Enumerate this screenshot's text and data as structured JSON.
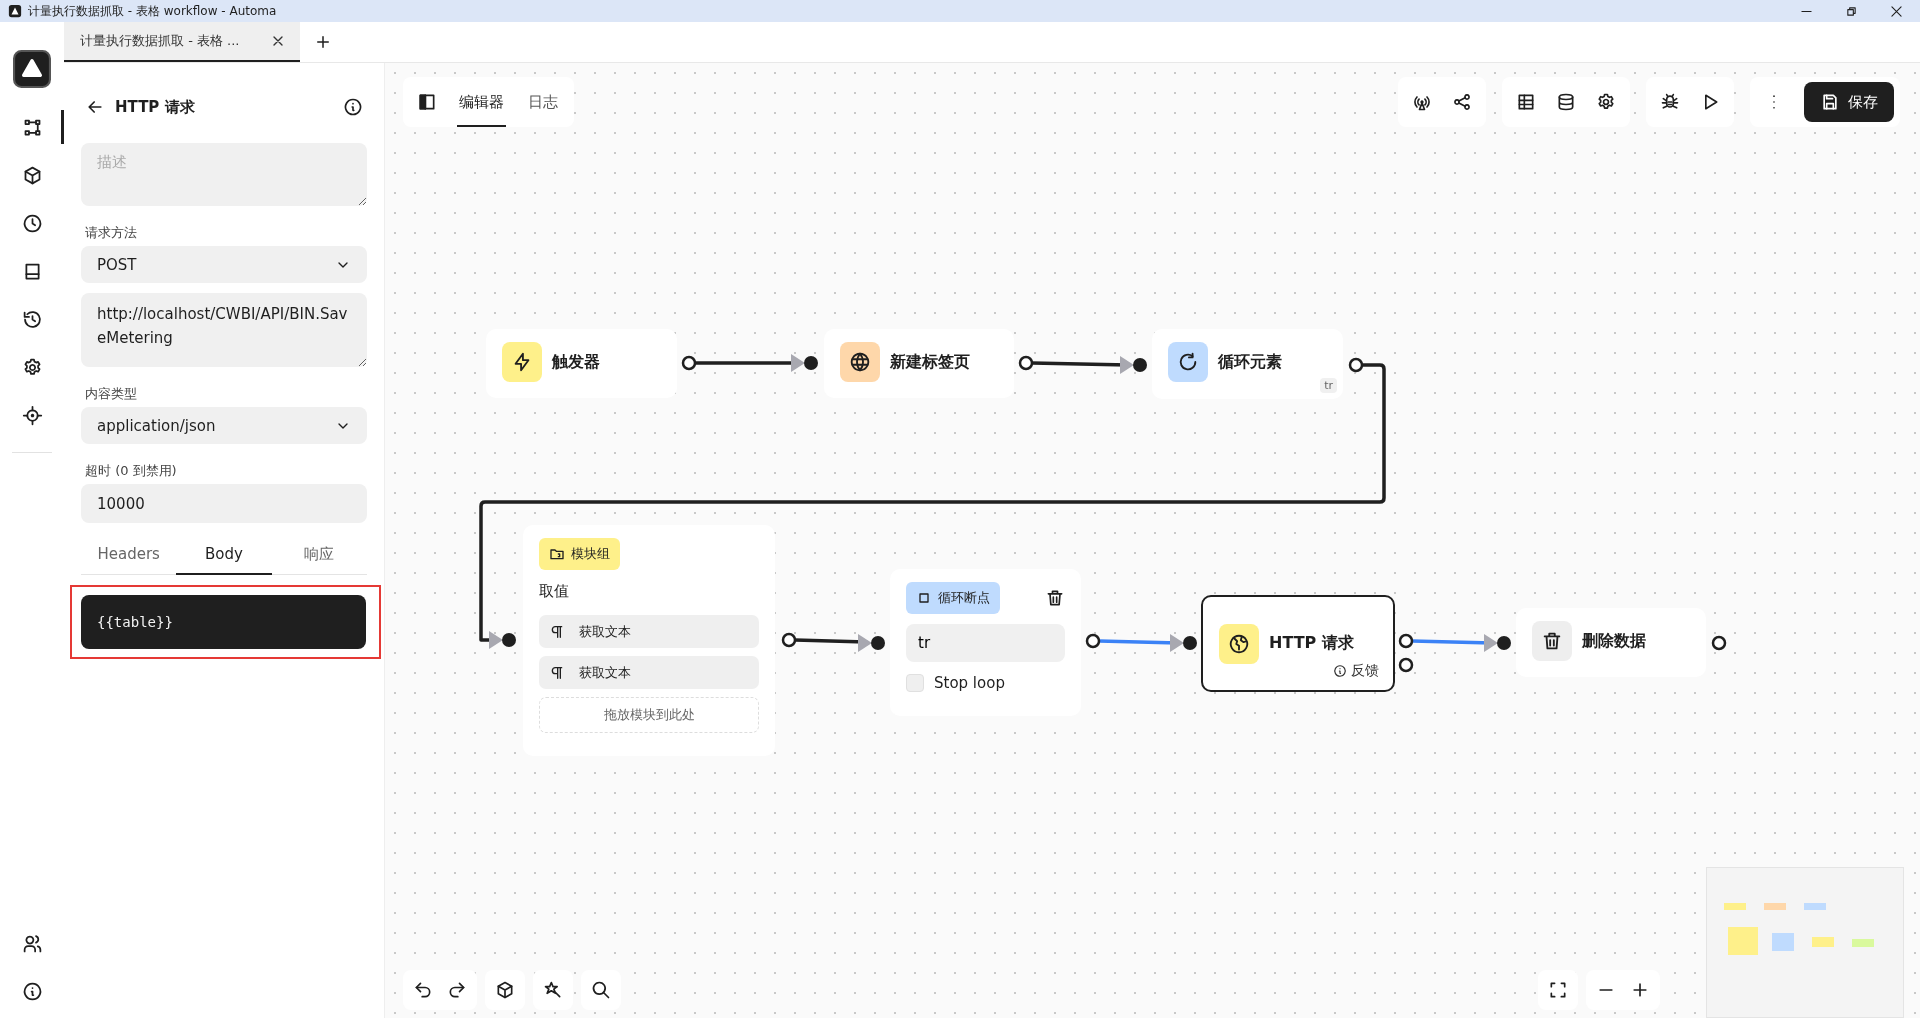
{
  "window": {
    "title": "计量执行数据抓取 - 表格 workflow - Automa"
  },
  "browser_tabs": [
    {
      "label": "计量执行数据抓取 - 表格 ...",
      "selected": true
    }
  ],
  "rail": [
    {
      "kind": "workflows",
      "selected": true
    },
    {
      "kind": "packages",
      "selected": false
    },
    {
      "kind": "schedule",
      "selected": false
    },
    {
      "kind": "storage",
      "selected": false
    },
    {
      "kind": "logs",
      "selected": false
    },
    {
      "kind": "settings",
      "selected": false
    },
    {
      "kind": "recording",
      "selected": false
    }
  ],
  "rail_bottom": [
    {
      "kind": "community",
      "selected": false
    },
    {
      "kind": "about",
      "selected": false
    }
  ],
  "panel": {
    "title": "HTTP 请求",
    "description": {
      "placeholder": "描述"
    },
    "method": {
      "label": "请求方法",
      "value": "POST"
    },
    "url": {
      "value": "http://localhost/CWBI/API/BIN.SaveMetering"
    },
    "content_type": {
      "label": "内容类型",
      "value": "application/json"
    },
    "timeout": {
      "label": "超时 (0 到禁用)",
      "value": "10000"
    },
    "tabs": [
      {
        "label": "Headers",
        "selected": false
      },
      {
        "label": "Body",
        "selected": true
      },
      {
        "label": "响应",
        "selected": false
      }
    ],
    "body": "{{table}}"
  },
  "editor_tabs": [
    {
      "label": "编辑器",
      "selected": true
    },
    {
      "label": "日志",
      "selected": false
    }
  ],
  "save_button": "保存",
  "nodes": [
    {
      "kind": "trigger",
      "label": "触发器",
      "color": "#fef08a",
      "selected": false
    },
    {
      "kind": "new-tab",
      "label": "新建标签页",
      "color": "#fed7aa",
      "selected": false
    },
    {
      "kind": "loop",
      "label": "循环元素",
      "color": "#bfdbfe",
      "selected": false,
      "badge": "tr"
    },
    {
      "kind": "group",
      "label": "模块组",
      "color": "#fef08a",
      "selected": false,
      "name": "取值",
      "items": [
        "获取文本",
        "获取文本"
      ],
      "drop_hint": "拖放模块到此处"
    },
    {
      "kind": "loop-breakpoint",
      "label": "循环断点",
      "color": "#bfdbfe",
      "selected": false,
      "value": "tr",
      "checkbox": {
        "label": "Stop loop",
        "checked": false
      }
    },
    {
      "kind": "http",
      "label": "HTTP 请求",
      "color": "#fef08a",
      "selected": true,
      "link": "反馈"
    },
    {
      "kind": "delete",
      "label": "删除数据",
      "color": "#eeeeee",
      "selected": false
    }
  ],
  "edges": [
    {
      "color": "#1f1f1f"
    },
    {
      "color": "#1f1f1f"
    },
    {
      "color": "#1f1f1f"
    },
    {
      "color": "#1f1f1f"
    },
    {
      "color": "#3b82f6"
    },
    {
      "color": "#3b82f6"
    }
  ]
}
